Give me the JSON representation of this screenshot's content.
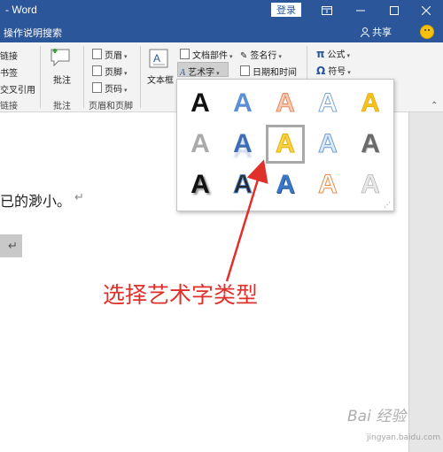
{
  "titlebar": {
    "title": "- Word",
    "login": "登录"
  },
  "tellbar": {
    "tell_me": "操作说明搜索",
    "share": "共享"
  },
  "ribbon": {
    "links_group": {
      "items": [
        "链接",
        "书签",
        "交叉引用"
      ],
      "group_label": "链接"
    },
    "comments_group": {
      "button": "批注",
      "group_label": "批注"
    },
    "header_footer_group": {
      "items": [
        "页眉",
        "页脚",
        "页码"
      ],
      "group_label": "页眉和页脚"
    },
    "text_group": {
      "textbox": "文本框",
      "quick_parts": "文档部件",
      "wordart": "艺术字",
      "signature_line": "签名行",
      "date_time": "日期和时间"
    },
    "symbols_group": {
      "equation": "公式",
      "symbol": "符号"
    }
  },
  "wordart_gallery": {
    "selected_index": 7,
    "styles": [
      {
        "char": "A",
        "style": "black-solid"
      },
      {
        "char": "A",
        "style": "blue-gradient"
      },
      {
        "char": "A",
        "style": "orange-outline"
      },
      {
        "char": "A",
        "style": "blue-outline"
      },
      {
        "char": "A",
        "style": "gold-solid"
      },
      {
        "char": "A",
        "style": "gray-gradient"
      },
      {
        "char": "A",
        "style": "blue-reflection"
      },
      {
        "char": "A",
        "style": "gold-glow"
      },
      {
        "char": "A",
        "style": "light-blue-outline"
      },
      {
        "char": "A",
        "style": "gray-metal"
      },
      {
        "char": "A",
        "style": "black-shadow"
      },
      {
        "char": "A",
        "style": "dark-outline"
      },
      {
        "char": "A",
        "style": "blue-bevel"
      },
      {
        "char": "A",
        "style": "orange-white"
      },
      {
        "char": "A",
        "style": "silver"
      }
    ]
  },
  "document": {
    "line1": "已的渺小。",
    "para_mark": "↵"
  },
  "annotation": {
    "text": "选择艺术字类型",
    "color": "#e0302a"
  },
  "watermark": {
    "text": "Bai 经验",
    "sub": "jingyan.baidu.com"
  },
  "colors": {
    "brand": "#2b579a",
    "ribbon_bg": "#f3f3f3",
    "arrow": "#e0302a"
  }
}
